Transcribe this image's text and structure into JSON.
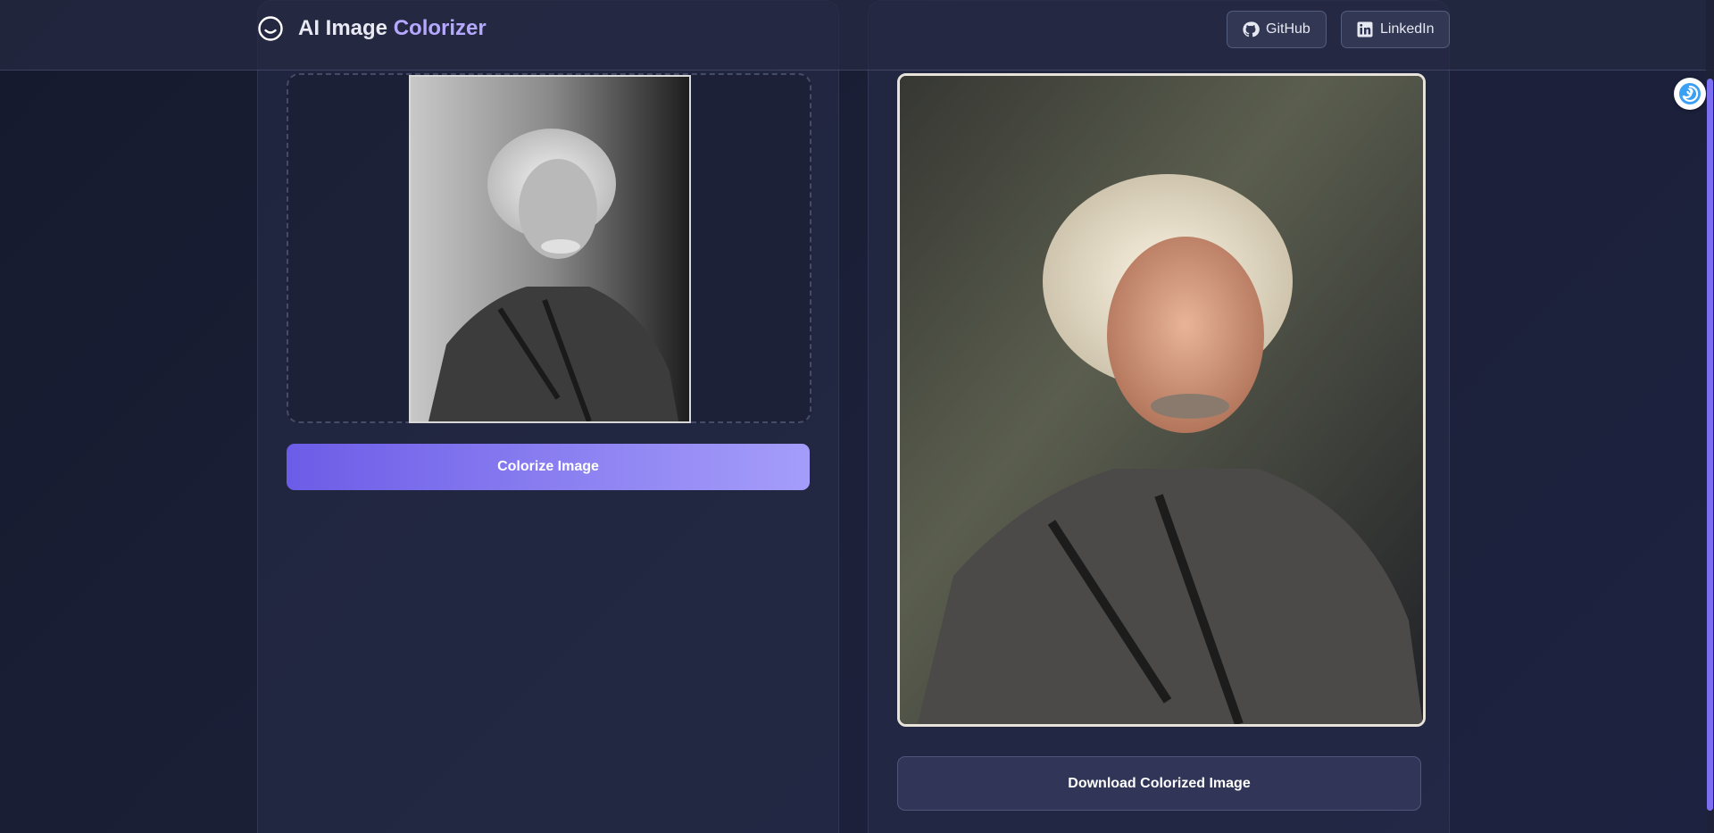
{
  "header": {
    "brand_main": "AI Image ",
    "brand_accent": "Colorizer",
    "brand_icon": "smile-circle-icon",
    "nav": [
      {
        "label": "GitHub",
        "icon": "github-icon"
      },
      {
        "label": "LinkedIn",
        "icon": "linkedin-icon"
      }
    ]
  },
  "upload_panel": {
    "image_icon": "original-photo",
    "button_label": "Colorize Image"
  },
  "result_panel": {
    "image_icon": "colorized-photo",
    "button_label": "Download Colorized Image"
  },
  "colors": {
    "accent": "#6c5ce7",
    "accent_light": "#a59dfa",
    "brand_accent": "#b5a8ff",
    "background": "#1b1f36"
  }
}
